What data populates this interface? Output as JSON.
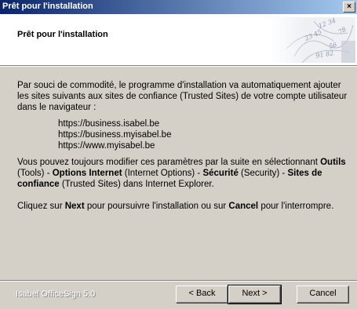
{
  "window": {
    "title": "Prêt pour l'installation",
    "close_label": "×"
  },
  "header": {
    "title": "Prêt pour l'installation"
  },
  "content": {
    "intro": "Par souci de commodité, le programme d'installation va automatiquement ajouter les sites suivants aux sites de confiance (Trusted Sites) de votre compte utilisateur dans le navigateur :",
    "urls": [
      "https://business.isabel.be",
      "https://business.myisabel.be",
      "https://www.myisabel.be"
    ],
    "modify": {
      "t1": "Vous pouvez toujours modifier ces paramètres par la suite en sélectionnant ",
      "b1": "Outils",
      "t2": " (Tools) - ",
      "b2": "Options Internet",
      "t3": " (Internet Options) - ",
      "b3": "Sécurité",
      "t4": " (Security) - ",
      "b4": "Sites de confiance",
      "t5": " (Trusted Sites) dans Internet Explorer."
    },
    "next_hint": {
      "t1": "Cliquez sur ",
      "b1": "Next",
      "t2": " pour poursuivre l'installation ou sur ",
      "b2": "Cancel",
      "t3": " pour l'interrompre."
    }
  },
  "footer": {
    "brand": "Isabel OfficeSign 5.0",
    "back_label": "< Back",
    "next_label": "Next >",
    "cancel_label": "Cancel"
  }
}
